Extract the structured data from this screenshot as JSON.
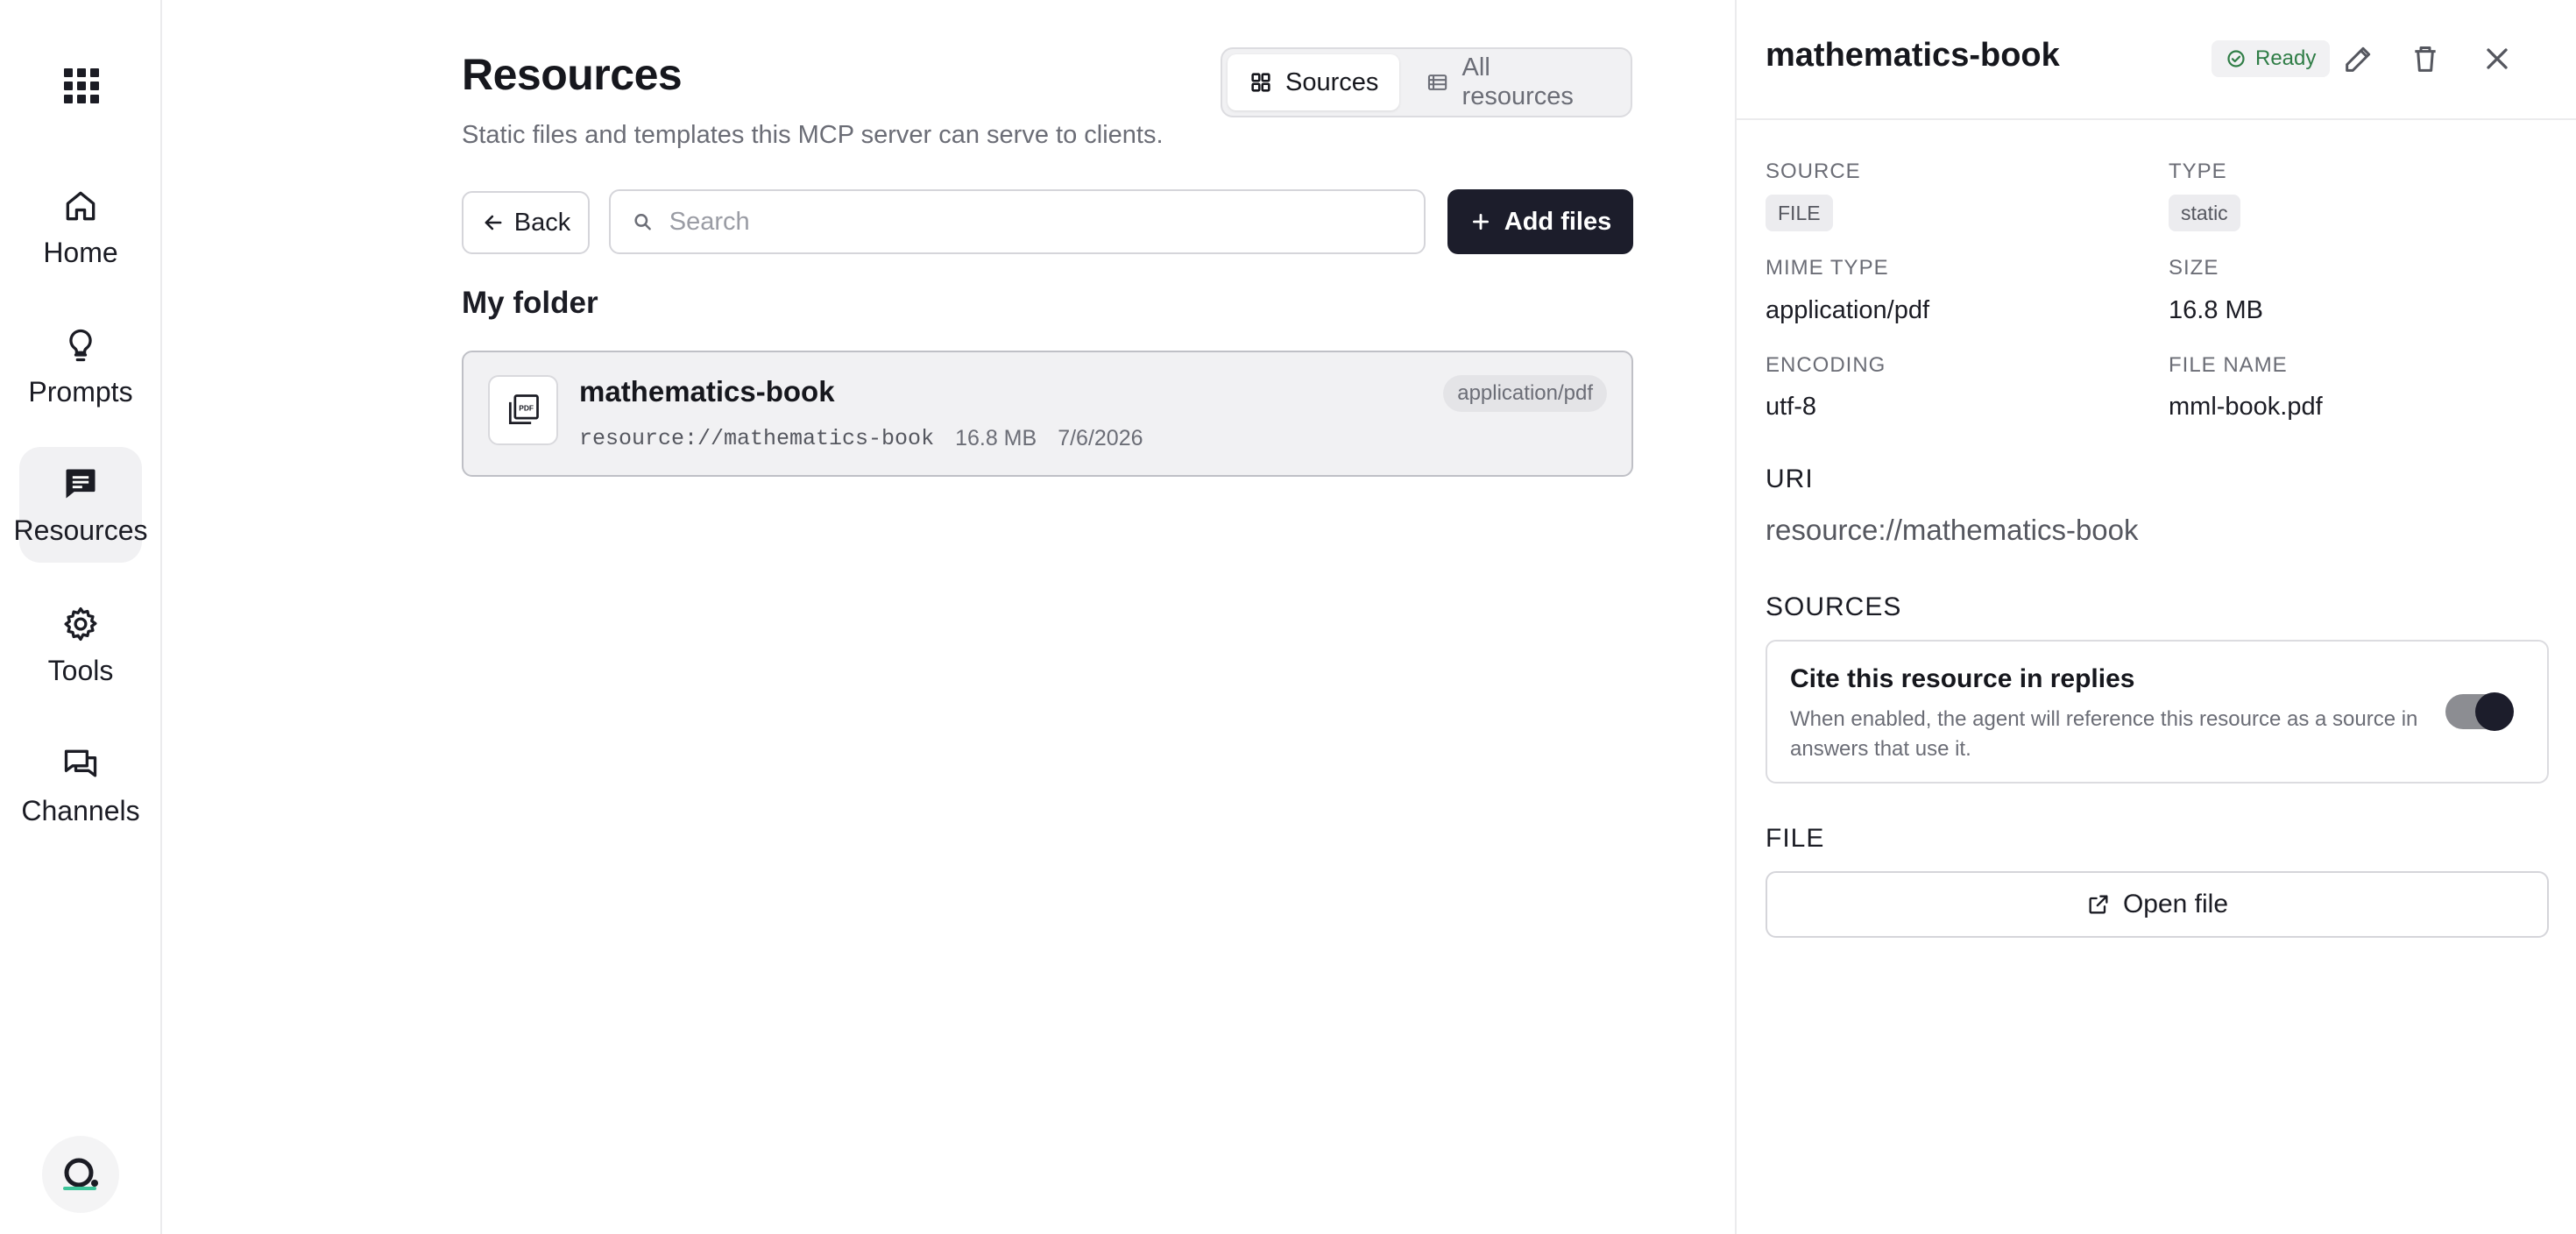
{
  "nav": {
    "apps_icon": "apps-grid-icon",
    "items": [
      {
        "label": "Home",
        "icon": "home-icon"
      },
      {
        "label": "Prompts",
        "icon": "lightbulb-icon"
      },
      {
        "label": "Resources",
        "icon": "message-icon",
        "active": true
      },
      {
        "label": "Tools",
        "icon": "gear-icon"
      },
      {
        "label": "Channels",
        "icon": "chat-bubbles-icon"
      }
    ],
    "logo_icon": "app-logo-icon"
  },
  "main": {
    "title": "Resources",
    "subtitle": "Static files and templates this MCP server can serve to clients.",
    "view_toggle": {
      "sources": "Sources",
      "all": "All resources",
      "selected": "Sources"
    },
    "back_label": "Back",
    "search_placeholder": "Search",
    "add_label": "Add files",
    "folder_title": "My folder",
    "resource": {
      "name": "mathematics-book",
      "uri": "resource://mathematics-book",
      "size": "16.8 MB",
      "date": "7/6/2026",
      "mime": "application/pdf"
    }
  },
  "panel": {
    "title": "mathematics-book",
    "status": "Ready",
    "status_color": "#2f7d46",
    "fields": {
      "source_label": "SOURCE",
      "source_value": "FILE",
      "type_label": "TYPE",
      "type_value": "static",
      "mime_label": "MIME TYPE",
      "mime_value": "application/pdf",
      "size_label": "SIZE",
      "size_value": "16.8 MB",
      "encoding_label": "ENCODING",
      "encoding_value": "utf-8",
      "filename_label": "FILE NAME",
      "filename_value": "mml-book.pdf"
    },
    "uri_heading": "URI",
    "uri_value": "resource://mathematics-book",
    "sources_heading": "SOURCES",
    "cite": {
      "title": "Cite this resource in replies",
      "description": "When enabled, the agent will reference this resource as a source in answers that use it.",
      "enabled": true
    },
    "file_heading": "FILE",
    "open_label": "Open file"
  }
}
